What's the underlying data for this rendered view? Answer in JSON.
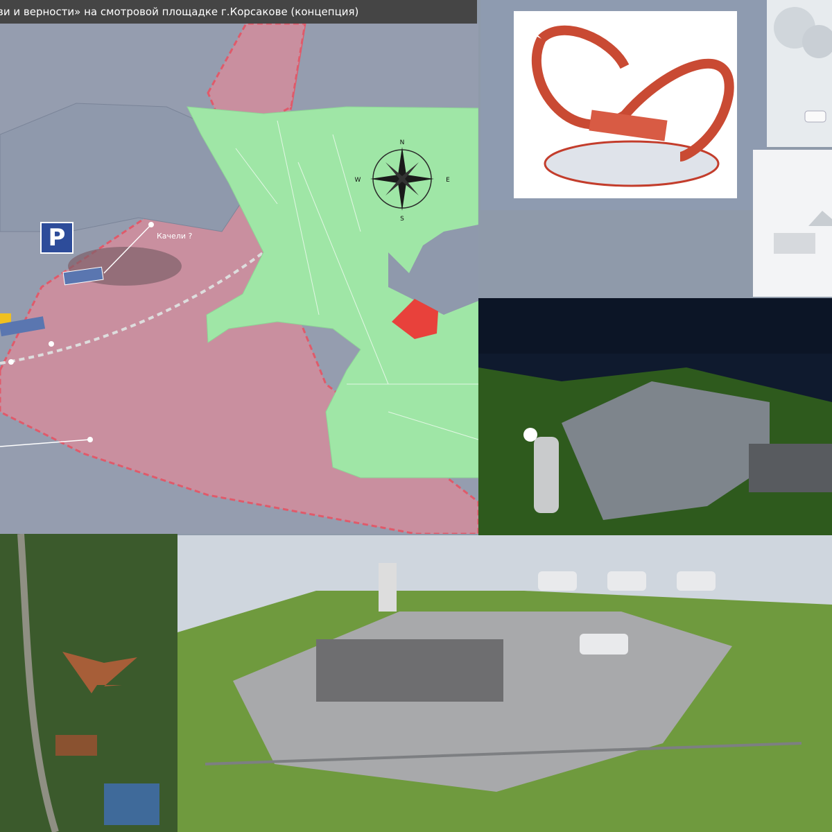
{
  "header": {
    "title": "ви и верности» на смотровой площадке г.Корсакове (концепция)"
  },
  "map": {
    "parking_sign": "P",
    "swing_label": "Качели ?",
    "compass": {
      "n": "N",
      "s": "S",
      "e": "E",
      "w": "W"
    }
  },
  "colors": {
    "title_bg": "#454545",
    "map_bg": "#959daf",
    "zone_pink": "#c98f9f",
    "zone_border": "#e05a6a",
    "green_area": "#9fe6a6",
    "site_red": "#e8413b",
    "parking_blue": "#2d4c9a"
  }
}
